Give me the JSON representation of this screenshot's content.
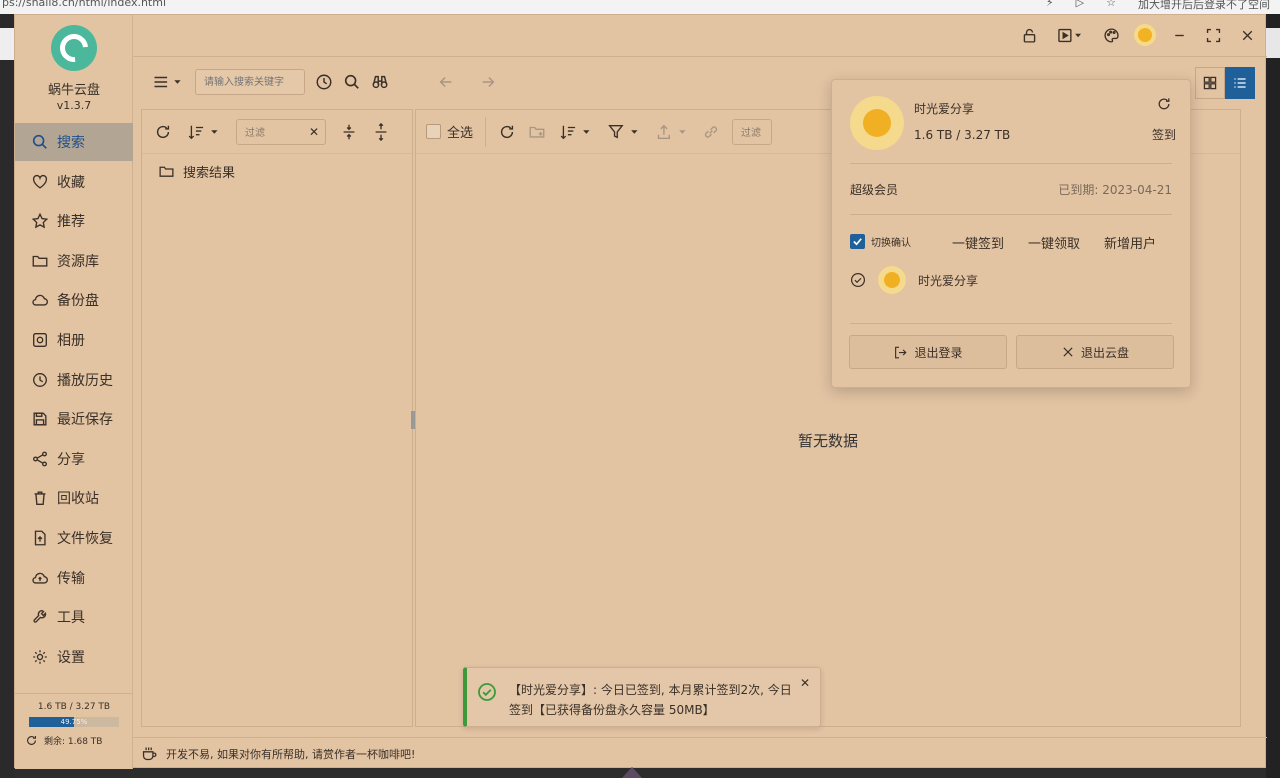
{
  "browser": {
    "url_fragment": "ps://snail8.cn/html/index.html",
    "right_text": "加大增开后后登录不了空间"
  },
  "app": {
    "name": "蜗牛云盘",
    "version": "v1.3.7"
  },
  "sidebar": {
    "items": [
      {
        "label": "搜索",
        "icon": "search-icon",
        "active": true
      },
      {
        "label": "收藏",
        "icon": "heart-icon"
      },
      {
        "label": "推荐",
        "icon": "star-icon"
      },
      {
        "label": "资源库",
        "icon": "folder-icon"
      },
      {
        "label": "备份盘",
        "icon": "cloud-icon"
      },
      {
        "label": "相册",
        "icon": "photo-icon"
      },
      {
        "label": "播放历史",
        "icon": "clock-icon"
      },
      {
        "label": "最近保存",
        "icon": "save-icon"
      },
      {
        "label": "分享",
        "icon": "share-icon"
      },
      {
        "label": "回收站",
        "icon": "trash-icon"
      },
      {
        "label": "文件恢复",
        "icon": "file-restore-icon"
      },
      {
        "label": "传输",
        "icon": "transfer-icon"
      },
      {
        "label": "工具",
        "icon": "wrench-icon"
      },
      {
        "label": "设置",
        "icon": "gear-icon"
      }
    ],
    "quota": {
      "used_total": "1.6 TB / 3.27 TB",
      "percent_label": "49.75%",
      "percent": 49.75,
      "remaining": "剩余: 1.68 TB"
    }
  },
  "search": {
    "placeholder": "请输入搜索关键字"
  },
  "tree": {
    "filter_placeholder": "过滤",
    "items": [
      {
        "label": "搜索结果"
      }
    ]
  },
  "files": {
    "select_all": "全选",
    "filter_placeholder": "过滤",
    "empty": "暂无数据"
  },
  "popover": {
    "username": "时光爱分享",
    "quota": "1.6 TB / 3.27 TB",
    "sign_in": "签到",
    "vip": "超级会员",
    "expired": "已到期: 2023-04-21",
    "switch_confirm": "切换确认",
    "one_click_sign": "一键签到",
    "one_click_claim": "一键领取",
    "add_user": "新增用户",
    "user_item": "时光爱分享",
    "logout": "退出登录",
    "exit_cloud": "退出云盘"
  },
  "toast": {
    "message": "【时光爱分享】: 今日已签到, 本月累计签到2次, 今日签到【已获得备份盘永久容量 50MB】"
  },
  "footer": {
    "text": "开发不易, 如果对你有所帮助, 请赏作者一杯咖啡吧!"
  },
  "colors": {
    "bg": "#e2c3a2",
    "accent": "#1f5f9a",
    "success": "#3c9a3a",
    "active_nav": "#b3a594"
  }
}
